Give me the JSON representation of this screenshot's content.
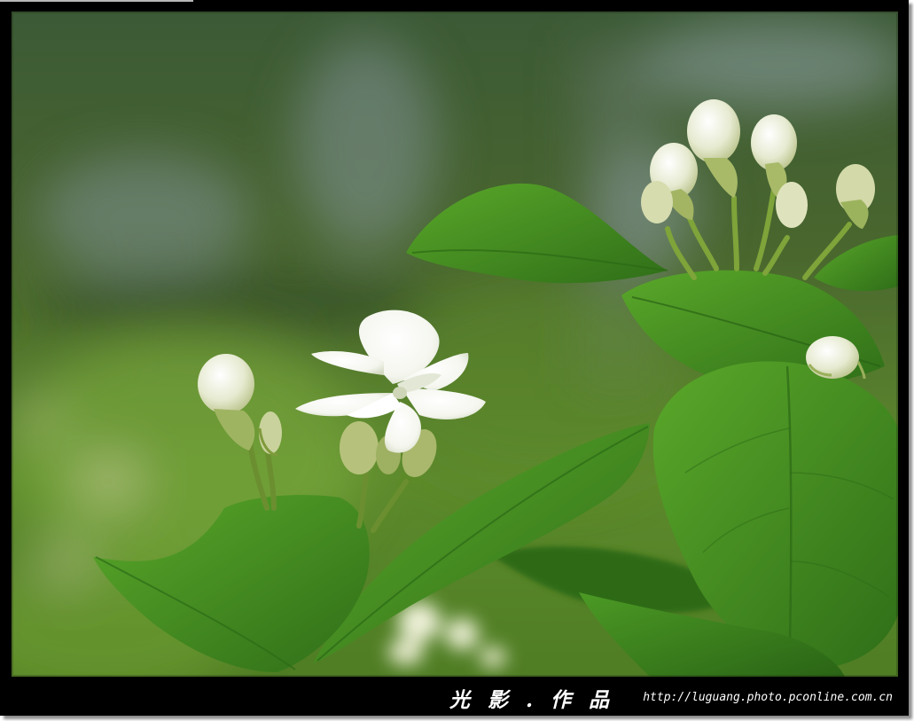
{
  "photo": {
    "subject": "white-jasmine-flower-with-buds-and-leaves"
  },
  "caption": {
    "brand": "光 影 . 作 品",
    "url": "http://luguang.photo.pconline.com.cn"
  },
  "colors": {
    "frame": "#000000",
    "caption_text": "#ffffff",
    "leaf": "#3f8a1f",
    "petal": "#f7f8f2"
  }
}
